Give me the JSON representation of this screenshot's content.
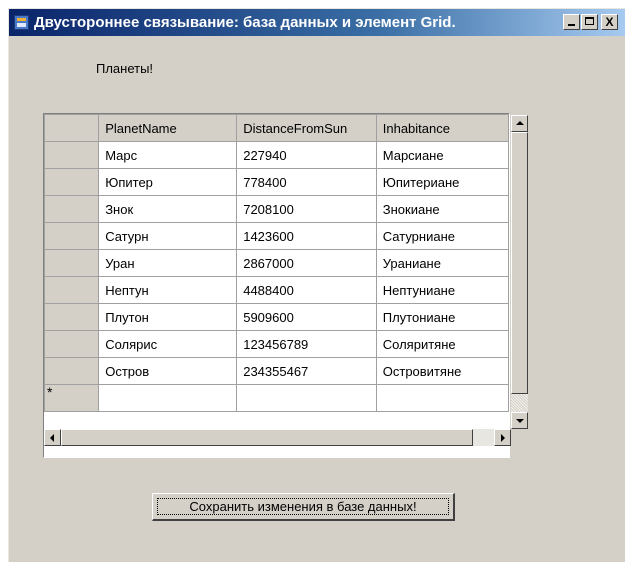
{
  "window": {
    "title": "Двустороннее связывание: база данных и элемент Grid.",
    "icon": "app-window-icon",
    "controls": {
      "minimize": "minimize-icon",
      "maximize": "maximize-icon",
      "close_label": "X"
    }
  },
  "label": {
    "text": "Планеты!"
  },
  "grid": {
    "columns": [
      "PlanetName",
      "DistanceFromSun",
      "Inhabitance"
    ],
    "rows": [
      [
        "Марс",
        "227940",
        "Марсиане"
      ],
      [
        "Юпитер",
        "778400",
        "Юпитериане"
      ],
      [
        "Знок",
        "7208100",
        "Знокиане"
      ],
      [
        "Сатурн",
        "1423600",
        "Сатурниане"
      ],
      [
        "Уран",
        "2867000",
        "Ураниане"
      ],
      [
        "Нептун",
        "4488400",
        "Нептуниане"
      ],
      [
        "Плутон",
        "5909600",
        "Плутониане"
      ],
      [
        "Солярис",
        "123456789",
        "Соляритяне"
      ],
      [
        "Остров",
        "234355467",
        "Островитяне"
      ]
    ],
    "new_row_marker": "*"
  },
  "save_button": {
    "label": "Сохранить изменения в базе данных!"
  }
}
